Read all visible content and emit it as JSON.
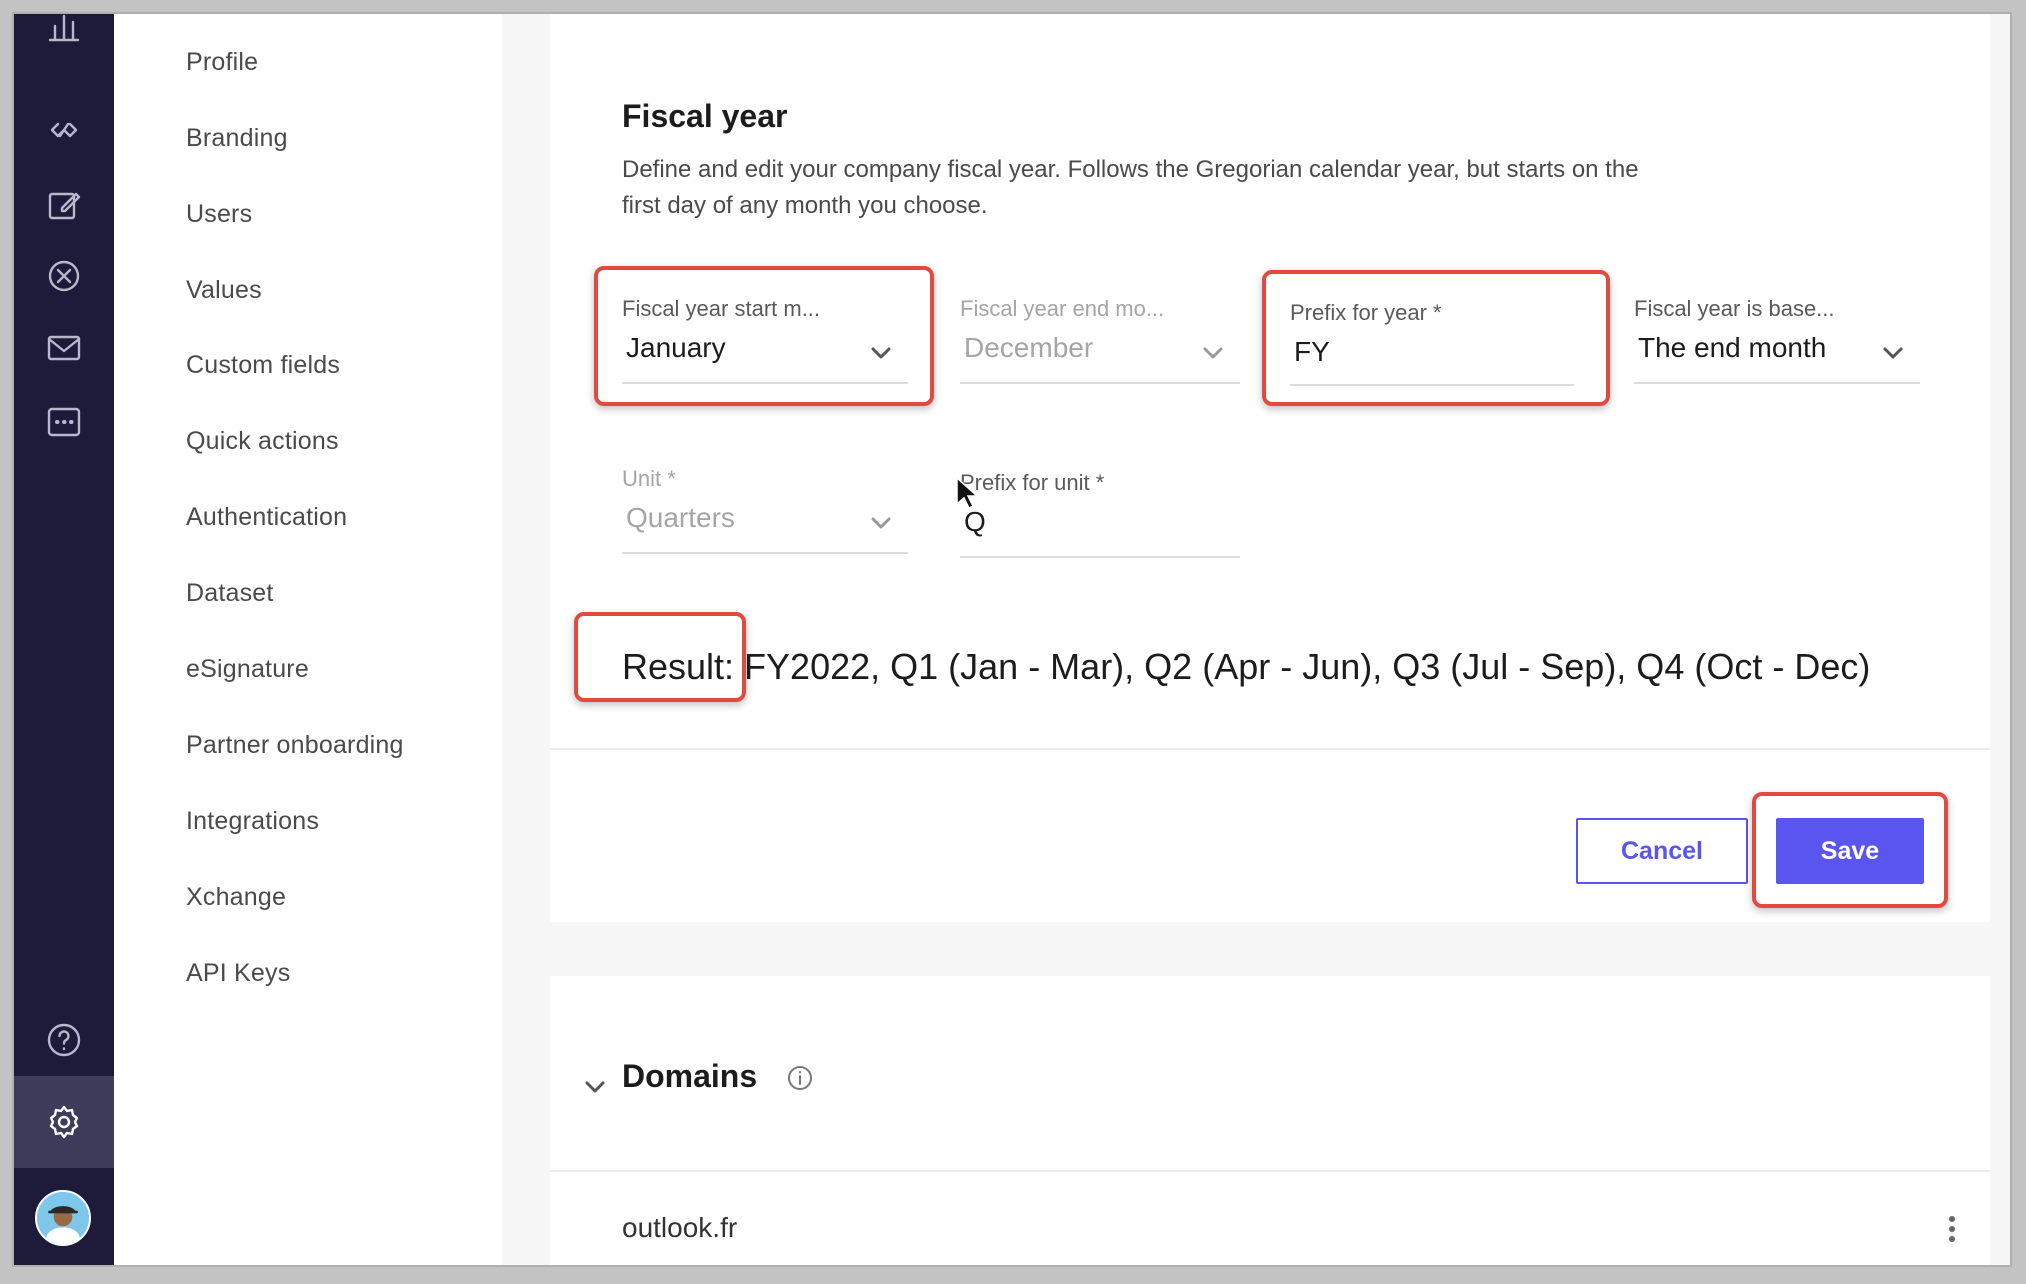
{
  "nav_rail": {
    "icons": [
      "chart-icon",
      "link-icon",
      "edit-icon",
      "cancel-circle-icon",
      "mail-icon",
      "chat-icon",
      "help-icon",
      "gear-icon",
      "avatar"
    ]
  },
  "sidebar": {
    "items": [
      "Profile",
      "Branding",
      "Users",
      "Values",
      "Custom fields",
      "Quick actions",
      "Authentication",
      "Dataset",
      "eSignature",
      "Partner onboarding",
      "Integrations",
      "Xchange",
      "API Keys"
    ]
  },
  "fiscal_year": {
    "title": "Fiscal year",
    "description": "Define and edit your company fiscal year. Follows the Gregorian calendar year, but starts on the first day of any month you choose.",
    "start_month": {
      "label": "Fiscal year start m...",
      "value": "January"
    },
    "end_month": {
      "label": "Fiscal year end mo...",
      "value": "December"
    },
    "prefix_year": {
      "label": "Prefix for year *",
      "value": "FY"
    },
    "based_on": {
      "label": "Fiscal year is base...",
      "value": "The end month"
    },
    "unit": {
      "label": "Unit *",
      "value": "Quarters"
    },
    "prefix_unit": {
      "label": "Prefix for unit *",
      "value": "Q"
    },
    "result": "Result: FY2022, Q1 (Jan - Mar), Q2 (Apr - Jun), Q3 (Jul - Sep), Q4 (Oct - Dec)"
  },
  "actions": {
    "cancel": "Cancel",
    "save": "Save"
  },
  "domains": {
    "title": "Domains",
    "items": [
      "outlook.fr"
    ]
  },
  "colors": {
    "accent": "#5b55f0",
    "highlight": "#e2493f",
    "rail": "#1d1a3a"
  }
}
